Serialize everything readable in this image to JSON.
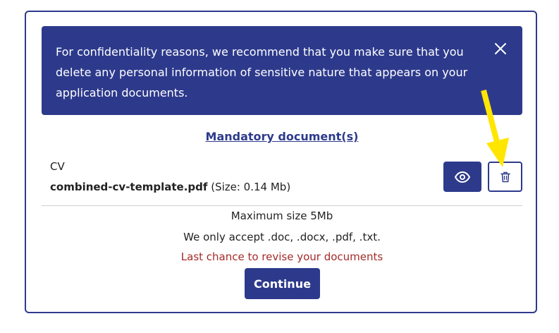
{
  "notice": {
    "text": "For confidentiality reasons, we recommend that you make sure that you delete any personal information of sensitive nature that appears on your application documents.",
    "close_icon": "close-icon"
  },
  "section": {
    "heading": "Mandatory document(s)"
  },
  "document": {
    "type": "CV",
    "filename": "combined-cv-template.pdf",
    "size_text": "(Size: 0.14 Mb)",
    "view_icon": "eye-icon",
    "delete_icon": "trash-icon"
  },
  "rules": {
    "max_size": "Maximum size 5Mb",
    "accepted_formats": "We only accept .doc, .docx, .pdf, .txt.",
    "warning": "Last chance to revise your documents"
  },
  "actions": {
    "continue_label": "Continue"
  },
  "colors": {
    "primary": "#2d3a8c",
    "warning": "#a52a2a",
    "annotation_arrow": "#ffe600"
  }
}
